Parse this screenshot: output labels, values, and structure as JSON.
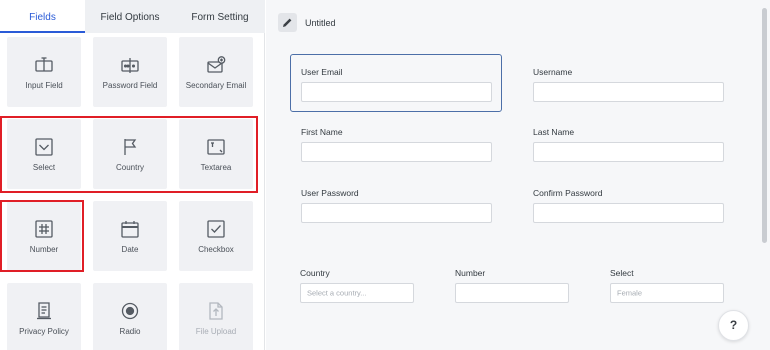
{
  "tabs": [
    {
      "label": "Fields",
      "active": true
    },
    {
      "label": "Field Options",
      "active": false
    },
    {
      "label": "Form Setting",
      "active": false
    }
  ],
  "fields_palette": [
    {
      "label": "Input Field",
      "icon": "input-field-icon"
    },
    {
      "label": "Password Field",
      "icon": "password-field-icon"
    },
    {
      "label": "Secondary Email",
      "icon": "secondary-email-icon"
    },
    {
      "label": "Select",
      "icon": "select-icon"
    },
    {
      "label": "Country",
      "icon": "flag-icon"
    },
    {
      "label": "Textarea",
      "icon": "textarea-icon"
    },
    {
      "label": "Number",
      "icon": "hash-icon"
    },
    {
      "label": "Date",
      "icon": "calendar-icon"
    },
    {
      "label": "Checkbox",
      "icon": "checkbox-icon"
    },
    {
      "label": "Privacy Policy",
      "icon": "document-icon"
    },
    {
      "label": "Radio",
      "icon": "radio-icon"
    },
    {
      "label": "File Upload",
      "icon": "file-upload-icon",
      "disabled": true
    }
  ],
  "form": {
    "title": "Untitled",
    "fields": [
      {
        "label": "User Email",
        "placeholder": ""
      },
      {
        "label": "Username",
        "placeholder": ""
      },
      {
        "label": "First Name",
        "placeholder": ""
      },
      {
        "label": "Last Name",
        "placeholder": ""
      },
      {
        "label": "User Password",
        "placeholder": ""
      },
      {
        "label": "Confirm Password",
        "placeholder": ""
      },
      {
        "label": "Country",
        "placeholder": "Select a country..."
      },
      {
        "label": "Number",
        "placeholder": ""
      },
      {
        "label": "Select",
        "placeholder": "Female"
      }
    ]
  },
  "help": {
    "label": "?"
  },
  "colors": {
    "accent": "#2a5bd7",
    "highlight": "#e01e26"
  }
}
